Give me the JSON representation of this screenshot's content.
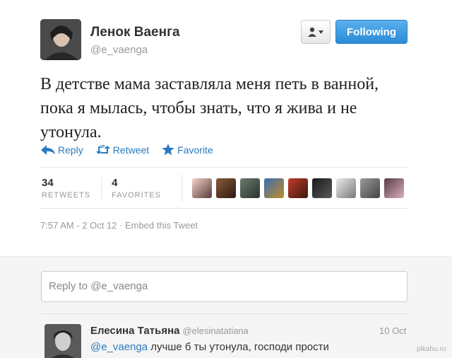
{
  "header": {
    "full_name": "Ленок Ваенга",
    "handle": "@e_vaenga",
    "follow_label": "Following"
  },
  "tweet": {
    "text": "В детстве мама заставляла меня петь в ванной, пока я мылась, чтобы знать, что я жива и не утонула.",
    "actions": {
      "reply": "Reply",
      "retweet": "Retweet",
      "favorite": "Favorite"
    },
    "stats": {
      "retweets_count": "34",
      "retweets_label": "RETWEETS",
      "favorites_count": "4",
      "favorites_label": "FAVORITES"
    },
    "timestamp": "7:57 AM - 2 Oct 12",
    "embed_label": "Embed this Tweet",
    "meta_separator": " · "
  },
  "reply_box": {
    "placeholder": "Reply to @e_vaenga"
  },
  "reply": {
    "name": "Елесина Татьяна",
    "handle": "@elesinatatiana",
    "time": "10 Oct",
    "mention": "@e_vaenga",
    "text": " лучше б ты утонула, господи прости"
  },
  "watermark": "pikabu.ru",
  "colors": {
    "link": "#2a7abf",
    "follow": "#2b8ad6"
  }
}
